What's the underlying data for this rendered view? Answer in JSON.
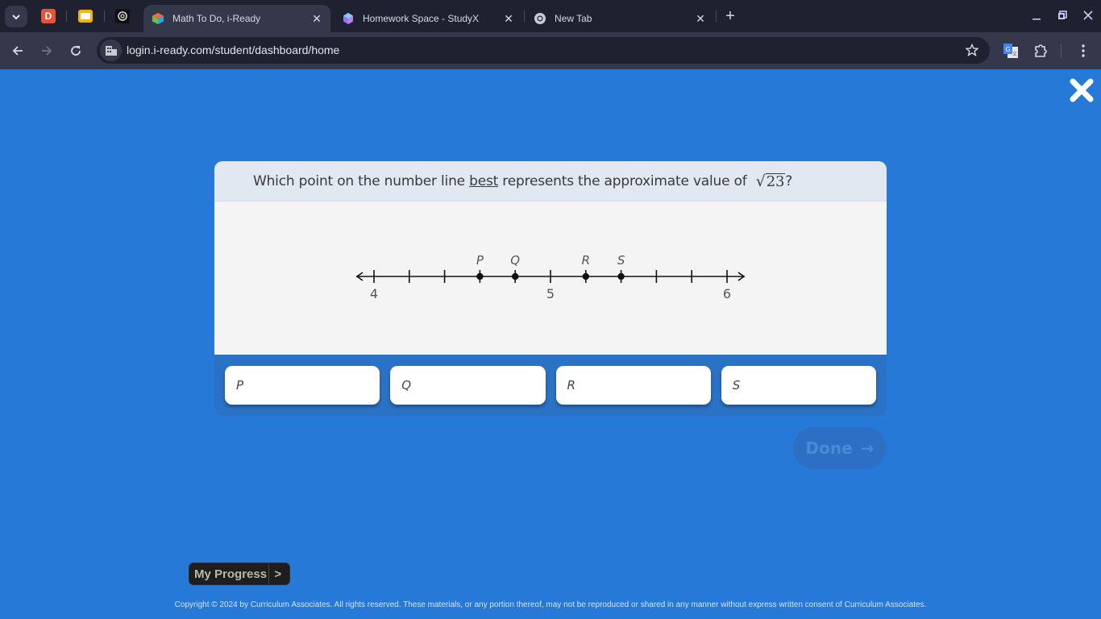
{
  "browser": {
    "pinned_tabs": [
      {
        "name": "dashlane",
        "glyph": "D",
        "color": "#e4533a"
      },
      {
        "name": "slides",
        "glyph": "",
        "color": "#f5b400"
      },
      {
        "name": "chatgpt",
        "glyph": "",
        "color": "#111111"
      }
    ],
    "tabs": [
      {
        "title": "Math To Do, i-Ready",
        "active": true
      },
      {
        "title": "Homework Space - StudyX",
        "active": false
      },
      {
        "title": "New Tab",
        "active": false
      }
    ],
    "url": "login.i-ready.com/student/dashboard/home"
  },
  "question": {
    "prefix": "Which point on the number line ",
    "emphasis": "best",
    "suffix": " represents the approximate value of ",
    "radicand": "23",
    "end": "?"
  },
  "number_line": {
    "min": 4,
    "max": 6,
    "tick_step": 0.2,
    "labels": [
      {
        "value": 4,
        "text": "4"
      },
      {
        "value": 5,
        "text": "5"
      },
      {
        "value": 6,
        "text": "6"
      }
    ],
    "points": [
      {
        "label": "P",
        "value": 4.6
      },
      {
        "label": "Q",
        "value": 4.8
      },
      {
        "label": "R",
        "value": 5.2
      },
      {
        "label": "S",
        "value": 5.4
      }
    ]
  },
  "choices": [
    "P",
    "Q",
    "R",
    "S"
  ],
  "done_label": "Done",
  "done_arrow": "→",
  "progress": {
    "label": "My Progress",
    "arrow": ">"
  },
  "copyright": "Copyright © 2024 by Curriculum Associates. All rights reserved. These materials, or any portion thereof, may not be reproduced or shared in any manner without express written consent of Curriculum Associates."
}
